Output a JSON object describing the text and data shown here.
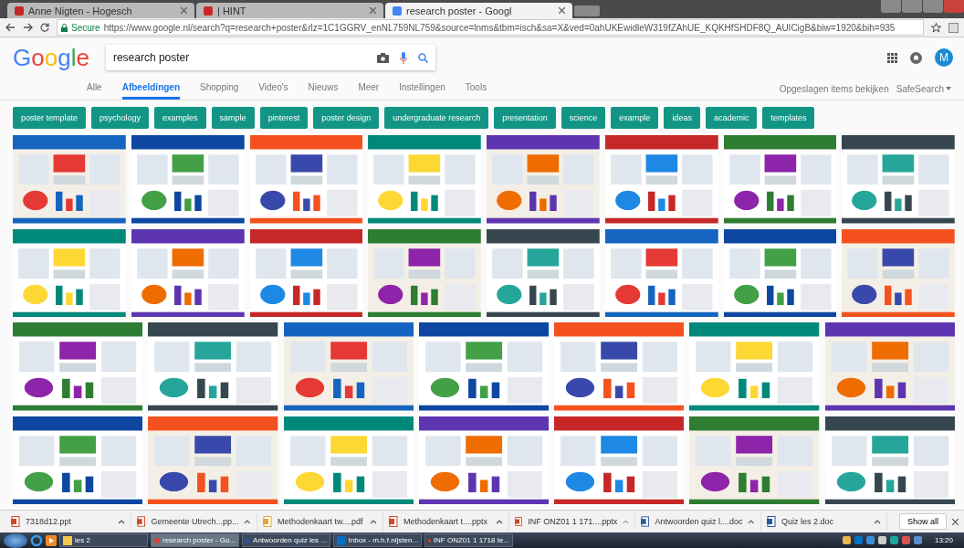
{
  "browser_tabs": [
    {
      "title": "Anne Nigten - Hogesch",
      "selected": false
    },
    {
      "title": "| HINT",
      "selected": false
    },
    {
      "title": "research poster - Googl",
      "selected": true
    }
  ],
  "address_bar": {
    "secure_label": "Secure",
    "url": "https://www.google.nl/search?q=research+poster&rlz=1C1GGRV_enNL759NL759&source=lnms&tbm=isch&sa=X&ved=0ahUKEwidleW319fZAhUE_KQKHfSHDF8Q_AUICigB&biw=1920&bih=935"
  },
  "header": {
    "logo": "Google",
    "search_value": "research poster",
    "avatar_letter": "M"
  },
  "nav_tabs": [
    {
      "label": "Alle",
      "selected": false
    },
    {
      "label": "Afbeeldingen",
      "selected": true
    },
    {
      "label": "Shopping",
      "selected": false
    },
    {
      "label": "Video's",
      "selected": false
    },
    {
      "label": "Nieuws",
      "selected": false
    },
    {
      "label": "Meer",
      "selected": false
    },
    {
      "label": "Instellingen",
      "selected": false
    },
    {
      "label": "Tools",
      "selected": false
    }
  ],
  "nav_right": {
    "saved": "Opgeslagen items bekijken",
    "safesearch": "SafeSearch"
  },
  "chips": [
    "poster template",
    "psychology",
    "examples",
    "sample",
    "pinterest",
    "poster design",
    "undergraduate research",
    "presentation",
    "science",
    "example",
    "ideas",
    "academic",
    "templates"
  ],
  "downloads": [
    {
      "name": "7318d12.ppt",
      "kind": "ppt"
    },
    {
      "name": "Gemeente Utrech...pp...",
      "kind": "ppt"
    },
    {
      "name": "Methodenkaart tw....pdf",
      "kind": "pdf"
    },
    {
      "name": "Methodenkaart t....pptx",
      "kind": "ppt"
    },
    {
      "name": "INF ONZ01 1 171....pptx",
      "kind": "ppt"
    },
    {
      "name": "Antwoorden quiz l....doc",
      "kind": "doc"
    },
    {
      "name": "Quiz les 2.doc",
      "kind": "doc"
    }
  ],
  "show_all": "Show all",
  "taskbar": {
    "items": [
      {
        "label": "les 2",
        "kind": "folder",
        "selected": false
      },
      {
        "label": "research poster - Go...",
        "kind": "chrome",
        "selected": true
      },
      {
        "label": "Antwoorden quiz les ...",
        "kind": "word",
        "selected": false
      },
      {
        "label": "Inbox - m.h.f.nijsten...",
        "kind": "outlook",
        "selected": false
      },
      {
        "label": "INF ONZ01 1 1718 te...",
        "kind": "ppt",
        "selected": false
      }
    ],
    "time": "13:20"
  }
}
